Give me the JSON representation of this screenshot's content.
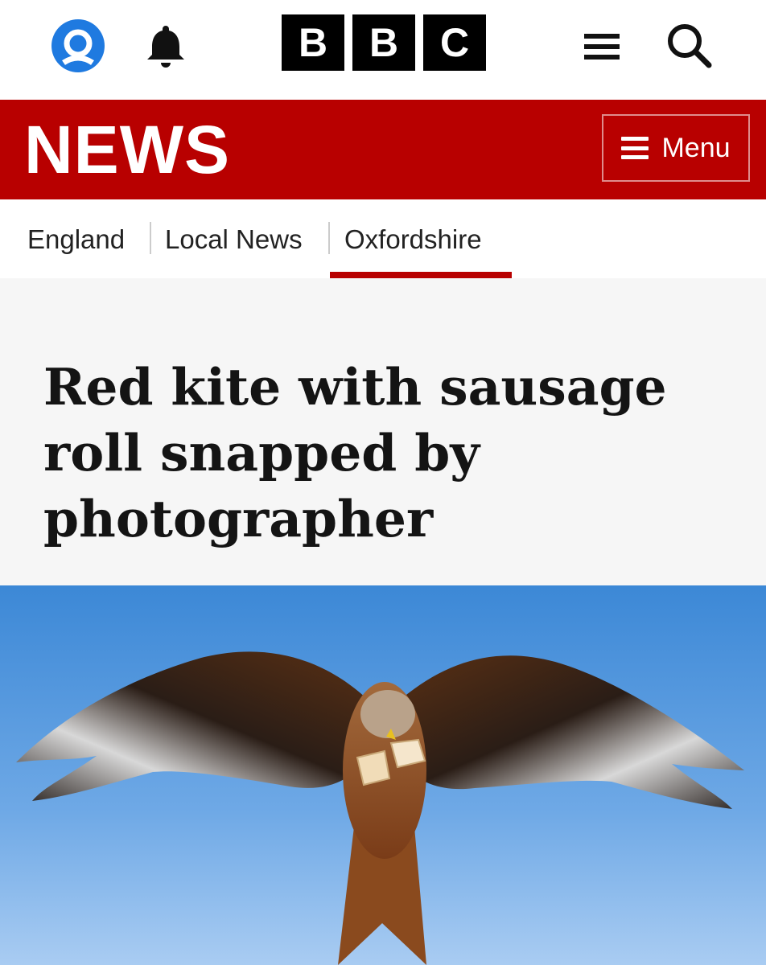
{
  "header": {
    "logo_letters": [
      "B",
      "B",
      "C"
    ],
    "icons": [
      "account-icon",
      "bell-icon",
      "hamburger-icon",
      "search-icon"
    ]
  },
  "newsbar": {
    "title": "NEWS",
    "menu_label": "Menu",
    "color": "#b80000"
  },
  "breadcrumb": {
    "items": [
      {
        "label": "England"
      },
      {
        "label": "Local News"
      },
      {
        "label": "Oxfordshire",
        "active": true
      }
    ]
  },
  "article": {
    "headline": "Red kite with sausage roll snapped by photographer"
  },
  "colors": {
    "accent": "#b80000",
    "account_blue": "#1f7ae0",
    "headline_bg": "#f6f6f6"
  }
}
